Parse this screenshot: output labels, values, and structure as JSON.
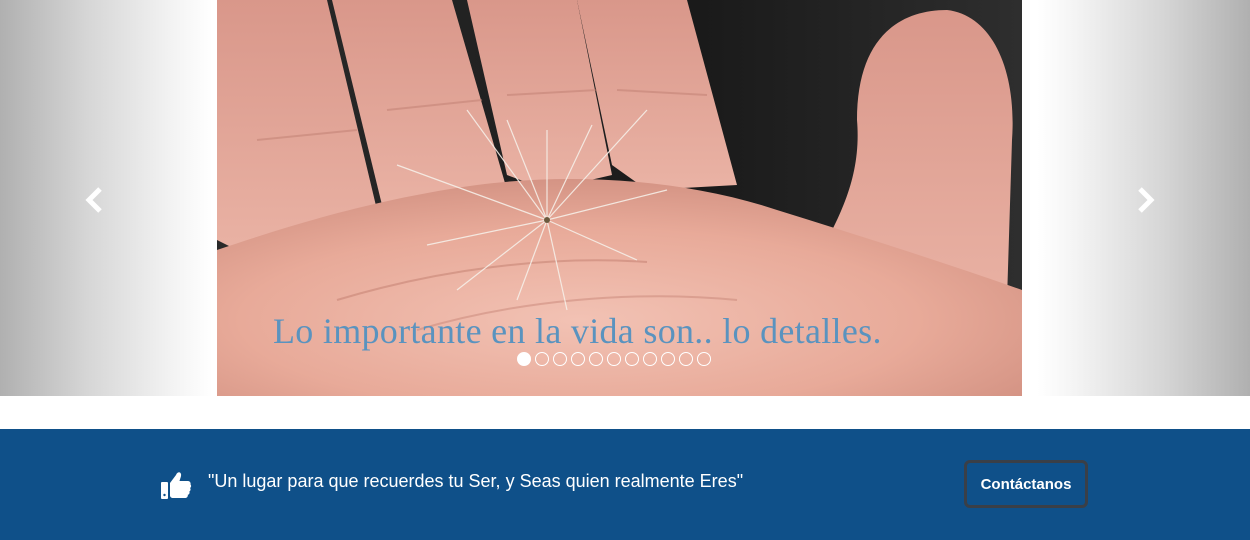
{
  "carousel": {
    "caption": "Lo importante en la vida son.. lo detalles.",
    "slide_count": 11,
    "active_slide": 0,
    "prev_icon": "chevron-left-icon",
    "next_icon": "chevron-right-icon"
  },
  "banner": {
    "icon": "thumbs-up-icon",
    "slogan": "\"Un lugar para que recuerdes tu Ser, y Seas quien realmente Eres\"",
    "contact_label": "Contáctanos"
  },
  "colors": {
    "banner_bg": "#0f5089",
    "caption": "#5a93bf",
    "button_border": "#3a3f47"
  }
}
